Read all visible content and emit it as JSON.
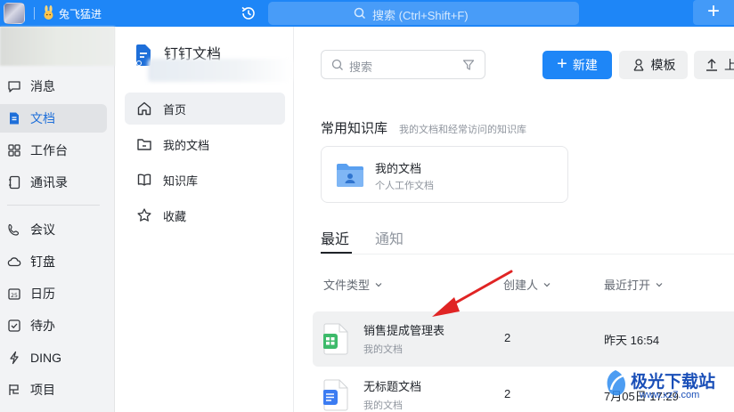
{
  "topbar": {
    "username": "兔飞猛进",
    "search_placeholder": "搜索 (Ctrl+Shift+F)",
    "add_label": "+"
  },
  "leftnav": {
    "items": [
      {
        "label": "消息",
        "icon": "message-icon"
      },
      {
        "label": "文档",
        "icon": "document-icon",
        "active": true
      },
      {
        "label": "工作台",
        "icon": "workbench-icon"
      },
      {
        "label": "通讯录",
        "icon": "contacts-icon"
      },
      {
        "label": "会议",
        "icon": "meeting-icon"
      },
      {
        "label": "钉盘",
        "icon": "cloud-drive-icon"
      },
      {
        "label": "日历",
        "icon": "calendar-icon"
      },
      {
        "label": "待办",
        "icon": "todo-icon"
      },
      {
        "label": "DING",
        "icon": "ding-icon"
      },
      {
        "label": "项目",
        "icon": "project-icon"
      }
    ]
  },
  "sidebar": {
    "title": "钉钉文档",
    "items": [
      {
        "label": "首页",
        "icon": "home-icon",
        "active": true
      },
      {
        "label": "我的文档",
        "icon": "folder-icon"
      },
      {
        "label": "知识库",
        "icon": "book-icon"
      },
      {
        "label": "收藏",
        "icon": "star-icon"
      }
    ]
  },
  "main": {
    "search_placeholder": "搜索",
    "new_label": "新建",
    "template_label": "模板",
    "upload_label": "上",
    "knowledge": {
      "title": "常用知识库",
      "subtitle": "我的文档和经常访问的知识库",
      "card_title": "我的文档",
      "card_subtitle": "个人工作文档"
    },
    "tabs": [
      {
        "label": "最近",
        "active": true
      },
      {
        "label": "通知"
      }
    ],
    "columns": [
      "文件类型",
      "创建人",
      "最近打开"
    ],
    "rows": [
      {
        "title": "销售提成管理表",
        "location": "我的文档",
        "creator": "2",
        "opened": "昨天 16:54",
        "type": "spreadsheet"
      },
      {
        "title": "无标题文档",
        "location": "我的文档",
        "creator": "2",
        "opened": "7月05日 17:29",
        "type": "document"
      }
    ]
  },
  "watermark": {
    "text": "极光下载站",
    "url": "www.xz7.com"
  },
  "colors": {
    "accent": "#1e86f7",
    "sheet_green": "#3dba6a",
    "doc_blue": "#3c7cf2",
    "arrow_red": "#e02424"
  }
}
